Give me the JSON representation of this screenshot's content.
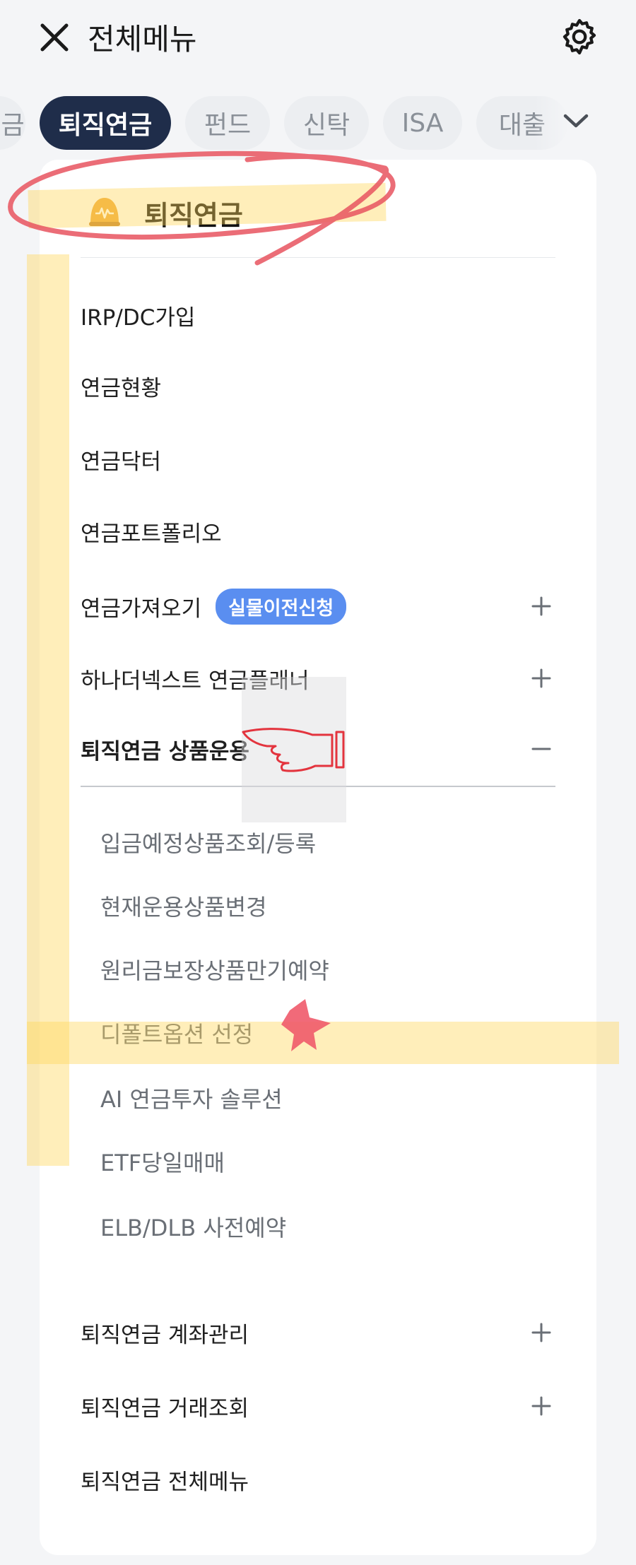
{
  "header": {
    "title": "전체메뉴",
    "close_icon": "close-icon",
    "settings_icon": "gear-icon"
  },
  "tabs": [
    {
      "label": "금",
      "active": false
    },
    {
      "label": "퇴직연금",
      "active": true
    },
    {
      "label": "펀드",
      "active": false
    },
    {
      "label": "신탁",
      "active": false
    },
    {
      "label": "ISA",
      "active": false
    },
    {
      "label": "대출",
      "active": false
    }
  ],
  "tabs_expand_icon": "chevron-down-icon",
  "section": {
    "icon": "piggy-bank-icon",
    "title": "퇴직연금"
  },
  "menu": {
    "irp_dc": "IRP/DC가입",
    "status": "연금현황",
    "doctor": "연금닥터",
    "portfolio": "연금포트폴리오",
    "import": "연금가져오기",
    "import_badge": "실물이전신청",
    "planner": "하나더넥스트 연금플래너",
    "product_ops": "퇴직연금 상품운용",
    "account_mgmt": "퇴직연금 계좌관리",
    "tx_inquiry": "퇴직연금 거래조회",
    "all_menu": "퇴직연금 전체메뉴"
  },
  "submenu": [
    "입금예정상품조회/등록",
    "현재운용상품변경",
    "원리금보장상품만기예약",
    "디폴트옵션 선정",
    "AI 연금투자 솔루션",
    "ETF당일매매",
    "ELB/DLB 사전예약"
  ],
  "colors": {
    "active_tab": "#1f2d4a",
    "badge": "#5a8ef0",
    "highlight": "#ffd65a",
    "annotation_red": "#e8545f"
  }
}
